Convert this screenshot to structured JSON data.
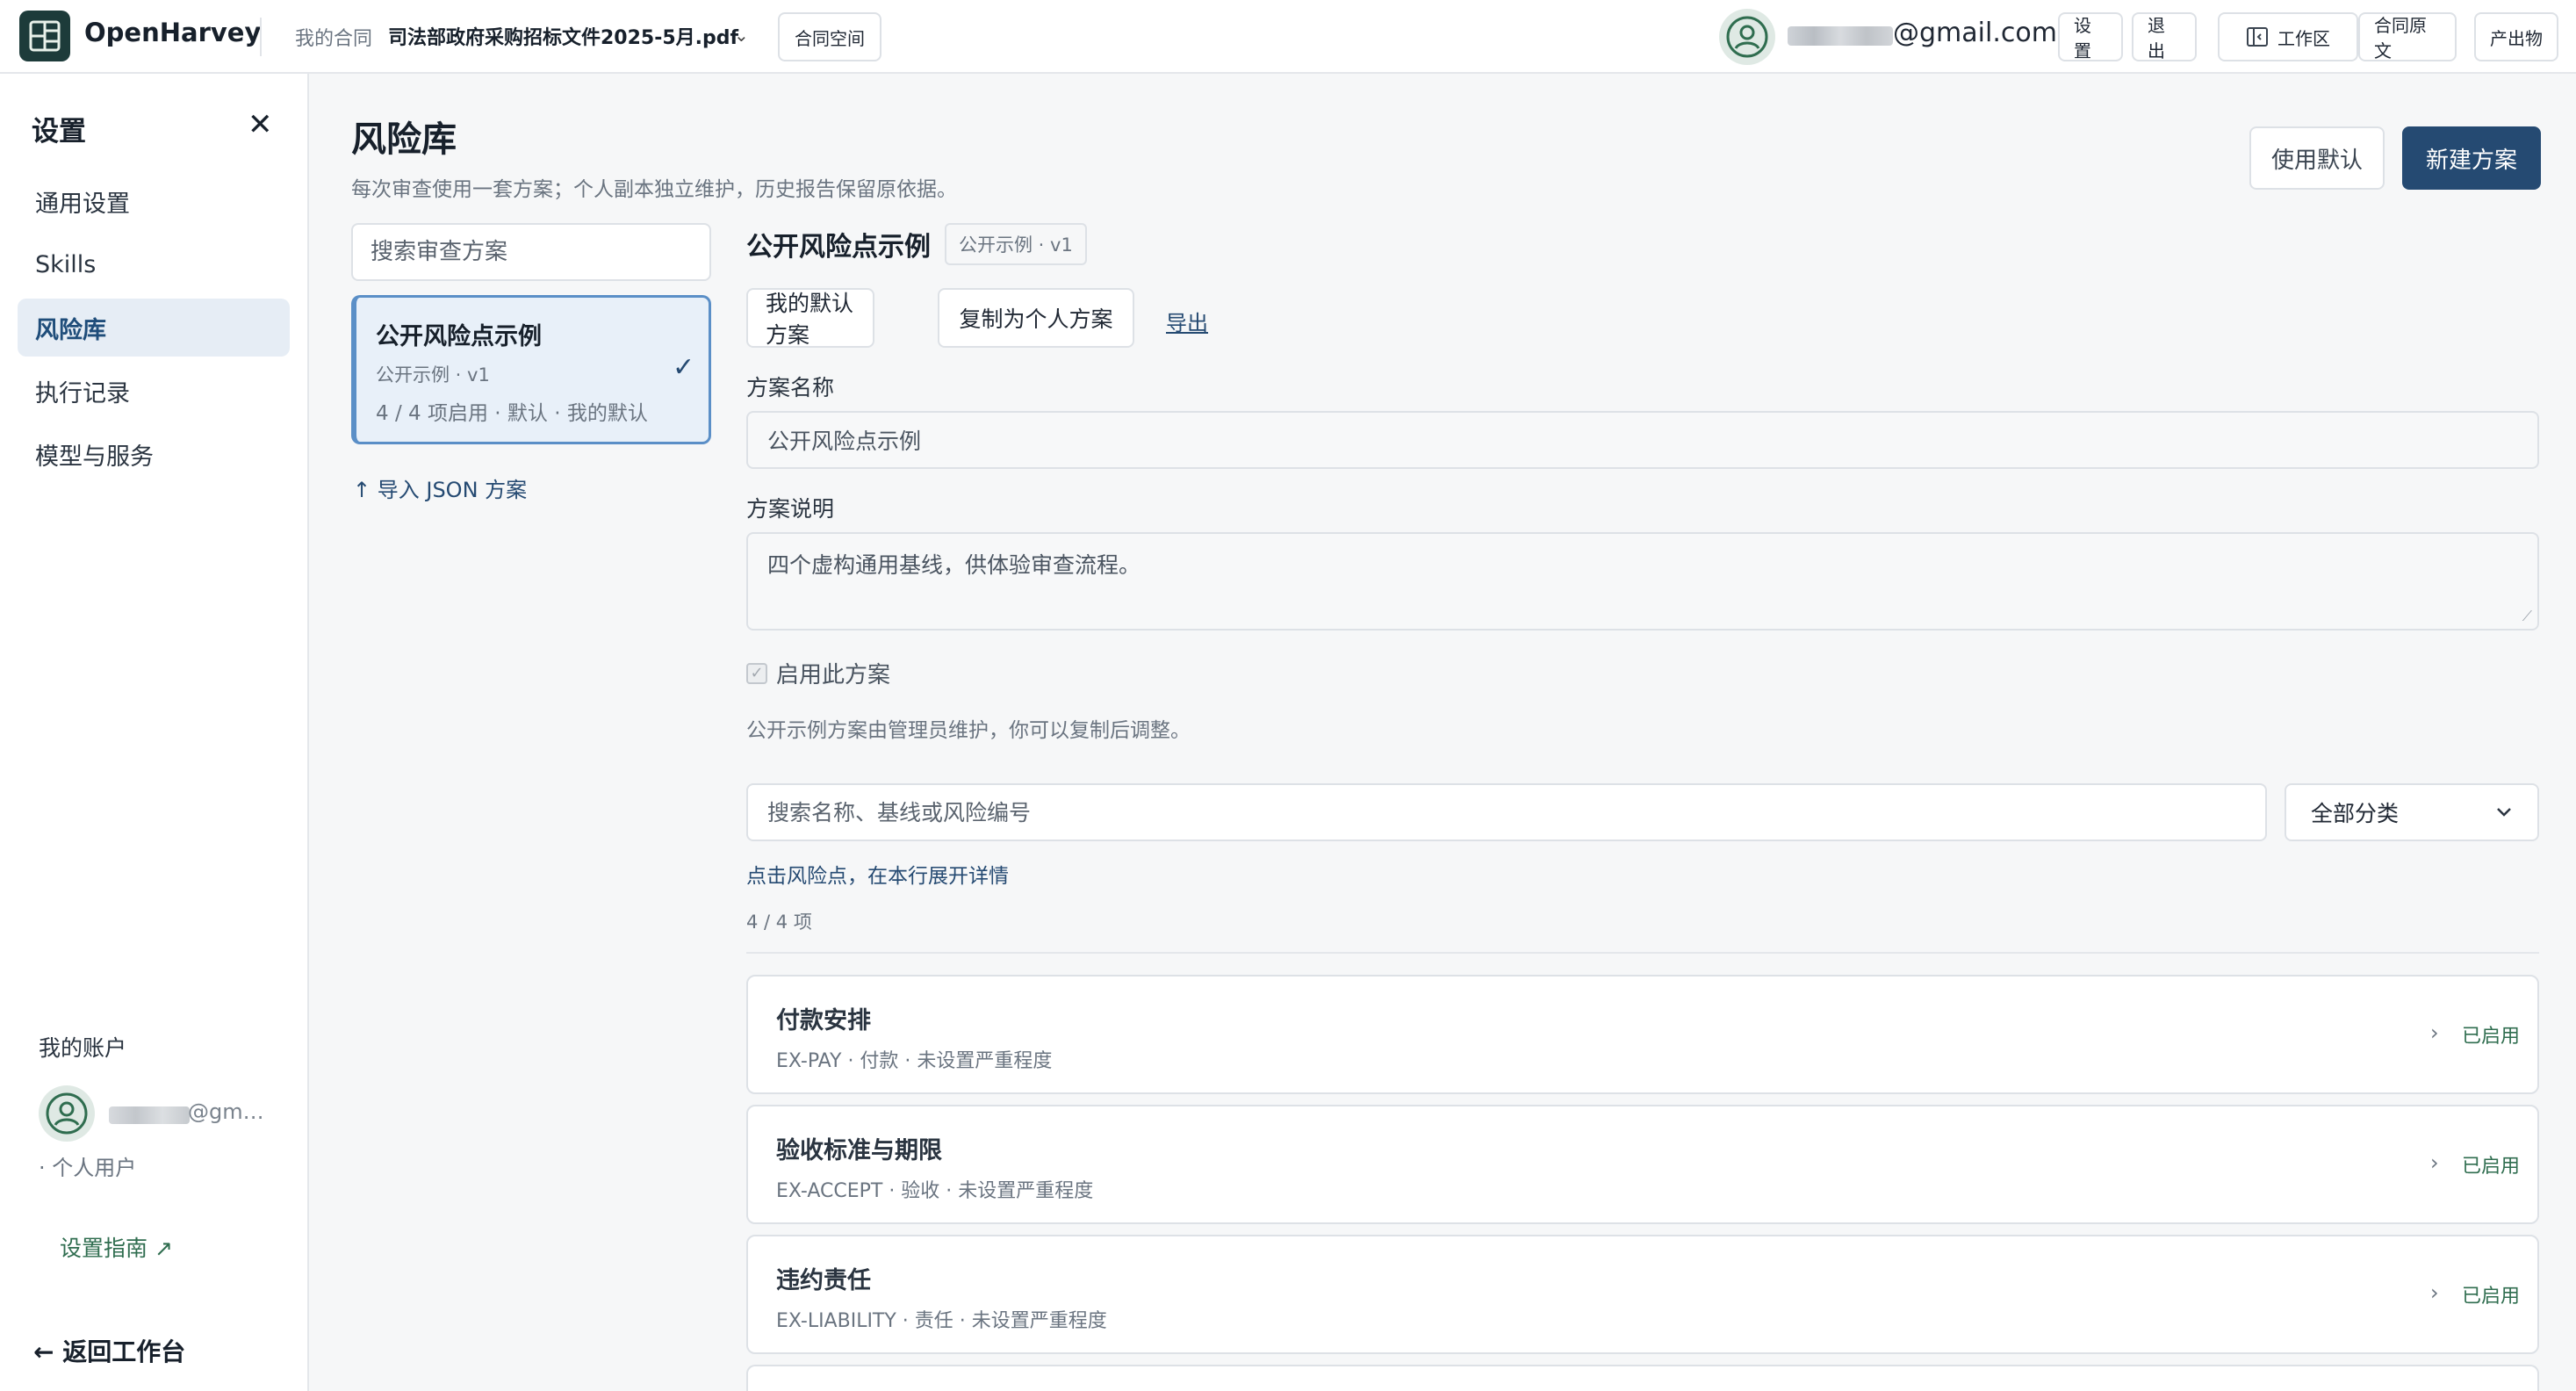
{
  "app": {
    "brand": "OpenHarvey",
    "breadcrumb_label": "我的合同",
    "file_name": "司法部政府采购招标文件2025-5月.pdf",
    "workspace_button": "合同空间",
    "user_email_suffix": "@gmail.com",
    "settings_button": "设置",
    "logout_button": "退出",
    "workbench_button": "工作区",
    "original_button": "合同原文",
    "output_button": "产出物"
  },
  "sidebar": {
    "title": "设置",
    "items": [
      {
        "label": "通用设置"
      },
      {
        "label": "Skills"
      },
      {
        "label": "风险库"
      },
      {
        "label": "执行记录"
      },
      {
        "label": "模型与服务"
      }
    ],
    "account_title": "我的账户",
    "account_email": "@gm…",
    "account_role": "· 个人用户",
    "guide_link": "设置指南 ↗",
    "back_link": "← 返回工作台"
  },
  "main": {
    "title": "风险库",
    "subtitle": "每次审查使用一套方案；个人副本独立维护，历史报告保留原依据。",
    "use_default_button": "使用默认",
    "new_plan_button": "新建方案",
    "plan_search_placeholder": "搜索审查方案",
    "plan_card": {
      "name": "公开风险点示例",
      "meta": "公开示例 · v1",
      "stats": "4 / 4 项启用 · 默认 · 我的默认",
      "check": "✓"
    },
    "import_link": "↑ 导入 JSON 方案"
  },
  "detail": {
    "title": "公开风险点示例",
    "tag": "公开示例 · v1",
    "my_default_button": "我的默认方案",
    "copy_button": "复制为个人方案",
    "export_link": "导出",
    "name_label": "方案名称",
    "name_value": "公开风险点示例",
    "desc_label": "方案说明",
    "desc_value": "四个虚构通用基线，供体验审查流程。",
    "enable_label": "启用此方案",
    "note": "公开示例方案由管理员维护，你可以复制后调整。",
    "risk_search_placeholder": "搜索名称、基线或风险编号",
    "category_select": "全部分类",
    "hint": "点击风险点，在本行展开详情",
    "count": "4 / 4 项"
  },
  "risks": [
    {
      "name": "付款安排",
      "meta": "EX-PAY · 付款 · 未设置严重程度",
      "status": "已启用"
    },
    {
      "name": "验收标准与期限",
      "meta": "EX-ACCEPT · 验收 · 未设置严重程度",
      "status": "已启用"
    },
    {
      "name": "违约责任",
      "meta": "EX-LIABILITY · 责任 · 未设置严重程度",
      "status": "已启用"
    }
  ],
  "colors": {
    "primary": "#254a72",
    "accent_green": "#2f6d4f",
    "sidebar_active_bg": "#e6edf5",
    "card_selected_border": "#5b8fc7"
  }
}
